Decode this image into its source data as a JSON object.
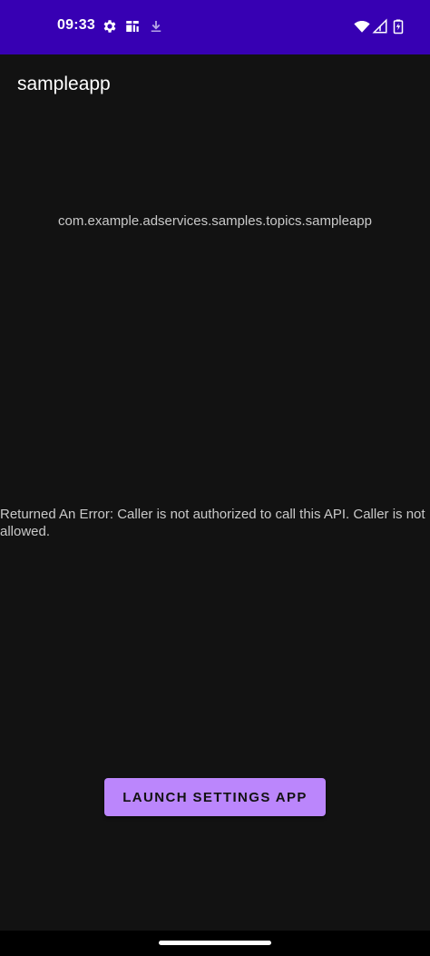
{
  "status_bar": {
    "time": "09:33",
    "left_icons": [
      "gear-icon",
      "notification-app-icon",
      "download-icon"
    ],
    "right_icons": [
      "wifi-icon",
      "cellular-signal-icon",
      "battery-icon"
    ],
    "background_color": "#3700b3"
  },
  "app_bar": {
    "title": "sampleapp"
  },
  "main": {
    "package_name": "com.example.adservices.samples.topics.sampleapp",
    "error_message": "Returned An Error: Caller is not authorized to call this API. Caller is not allowed.",
    "launch_button_label": "Launch Settings App"
  },
  "colors": {
    "accent": "#bb86fc",
    "background": "#121212",
    "text": "#c9c9c9"
  }
}
